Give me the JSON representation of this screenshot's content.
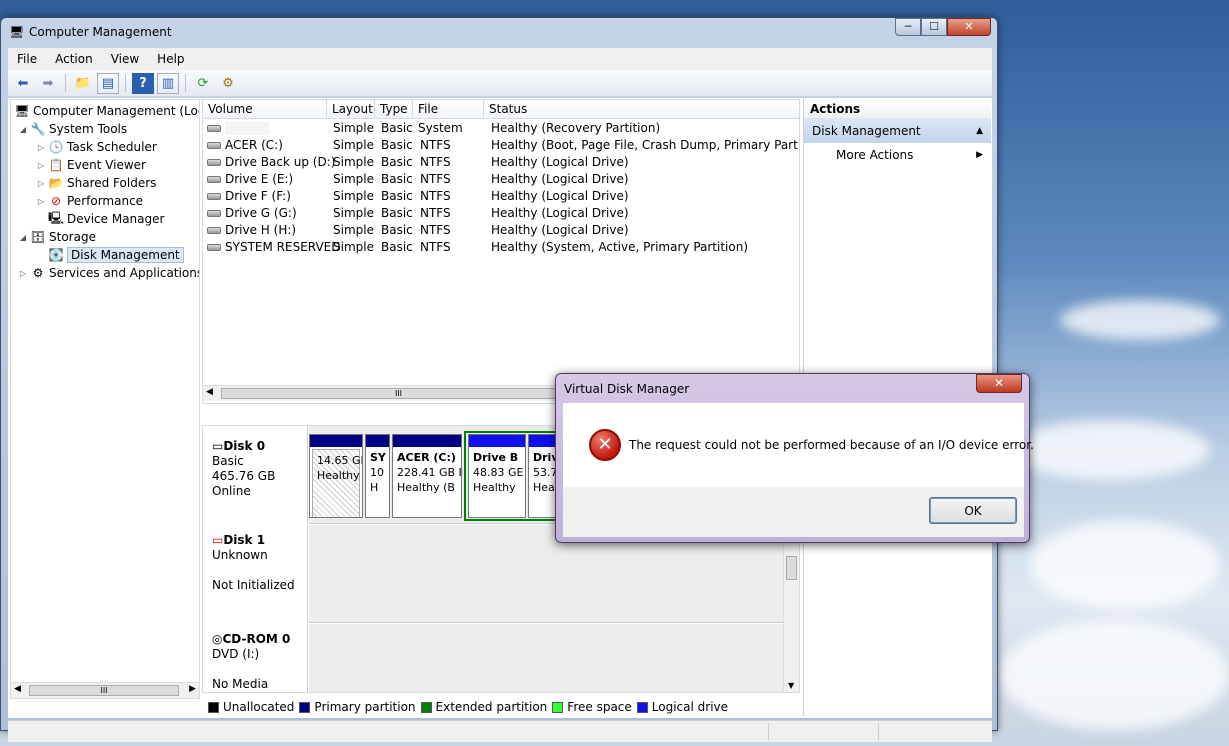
{
  "window": {
    "title": "Computer Management",
    "controls": {
      "minimize": "─",
      "maximize": "☐",
      "close": "✕"
    }
  },
  "menu": [
    "File",
    "Action",
    "View",
    "Help"
  ],
  "tree": {
    "items": [
      {
        "label": "Computer Management (Local",
        "icon": "computer-management-icon"
      },
      {
        "label": "System Tools",
        "icon": "tools-icon"
      },
      {
        "label": "Task Scheduler",
        "icon": "clock-icon"
      },
      {
        "label": "Event Viewer",
        "icon": "event-viewer-icon"
      },
      {
        "label": "Shared Folders",
        "icon": "folder-icon"
      },
      {
        "label": "Performance",
        "icon": "performance-icon"
      },
      {
        "label": "Device Manager",
        "icon": "device-manager-icon"
      },
      {
        "label": "Storage",
        "icon": "storage-icon"
      },
      {
        "label": "Disk Management",
        "icon": "disk-management-icon"
      },
      {
        "label": "Services and Applications",
        "icon": "services-icon"
      }
    ]
  },
  "volumes": {
    "headers": [
      "Volume",
      "Layout",
      "Type",
      "File System",
      "Status"
    ],
    "rows": [
      [
        "",
        "Simple",
        "Basic",
        "",
        "Healthy (Recovery Partition)"
      ],
      [
        "ACER (C:)",
        "Simple",
        "Basic",
        "NTFS",
        "Healthy (Boot, Page File, Crash Dump, Primary Partition)"
      ],
      [
        "Drive Back up (D:)",
        "Simple",
        "Basic",
        "NTFS",
        "Healthy (Logical Drive)"
      ],
      [
        "Drive E (E:)",
        "Simple",
        "Basic",
        "NTFS",
        "Healthy (Logical Drive)"
      ],
      [
        "Drive F (F:)",
        "Simple",
        "Basic",
        "NTFS",
        "Healthy (Logical Drive)"
      ],
      [
        "Drive G (G:)",
        "Simple",
        "Basic",
        "NTFS",
        "Healthy (Logical Drive)"
      ],
      [
        "Drive H (H:)",
        "Simple",
        "Basic",
        "NTFS",
        "Healthy (Logical Drive)"
      ],
      [
        "SYSTEM RESERVED",
        "Simple",
        "Basic",
        "NTFS",
        "Healthy (System, Active, Primary Partition)"
      ]
    ]
  },
  "disks": [
    {
      "name": "Disk 0",
      "line1": "Basic",
      "line2": "465.76 GB",
      "line3": "Online"
    },
    {
      "name": "Disk 1",
      "line1": "Unknown",
      "line2": "",
      "line3": "Not Initialized"
    },
    {
      "name": "CD-ROM 0",
      "line1": "DVD (I:)",
      "line2": "",
      "line3": "No Media"
    }
  ],
  "partitions": [
    {
      "title": "",
      "size": "14.65 GI",
      "status": "Healthy"
    },
    {
      "title": "SY",
      "size": "10",
      "status": "H"
    },
    {
      "title": "ACER  (C:)",
      "size": "228.41 GB I",
      "status": "Healthy (B"
    },
    {
      "title": "Drive B",
      "size": "48.83 GE",
      "status": "Healthy"
    },
    {
      "title": "Driv",
      "size": "53.7",
      "status": "Heal"
    }
  ],
  "legend": [
    {
      "label": "Unallocated",
      "color": "#000000"
    },
    {
      "label": "Primary partition",
      "color": "#020085"
    },
    {
      "label": "Extended partition",
      "color": "#008000"
    },
    {
      "label": "Free space",
      "color": "#33ff33"
    },
    {
      "label": "Logical drive",
      "color": "#1010ee"
    }
  ],
  "actions": {
    "header": "Actions",
    "section": "Disk Management",
    "item": "More Actions"
  },
  "dialog": {
    "title": "Virtual Disk Manager",
    "message": "The request could not be performed because of an I/O device error.",
    "ok": "OK",
    "close": "✕"
  },
  "scroll": {
    "grip": "III"
  }
}
